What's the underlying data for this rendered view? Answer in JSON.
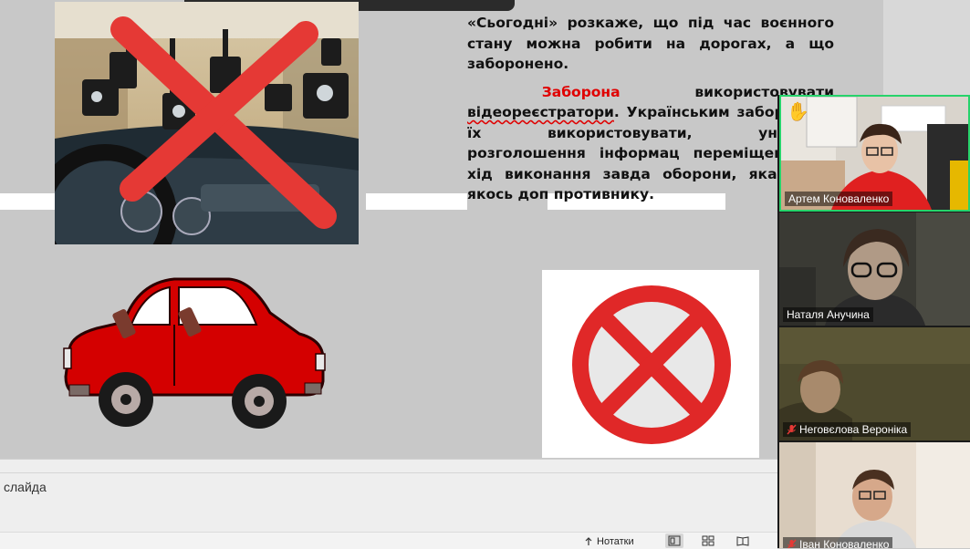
{
  "slide": {
    "paragraph1": "«Сьогодні» розкаже, що під час воєнного стану можна робити на дорогах, а що заборонено.",
    "paragraph2_red": "Заборона",
    "paragraph2_rest_a": " використовувати ",
    "paragraph2_squiggle": "відеореєстратори",
    "paragraph2_rest_b": ". Українським заборонили їх використовувати, уникнути розголошення інформац переміщення та хід виконання завда оборони, яка може якось доп противнику."
  },
  "notes": {
    "placeholder": "слайда"
  },
  "status_bar": {
    "notes_label": "Нотатки",
    "icons": [
      "notes-icon",
      "normal-view-icon",
      "slide-sorter-icon",
      "reading-view-icon"
    ]
  },
  "participants": [
    {
      "name": "Артем Коноваленко",
      "active_speaker": true,
      "hand_raised": true,
      "muted": false
    },
    {
      "name": "Наталя Анучина",
      "active_speaker": false,
      "hand_raised": false,
      "muted": false
    },
    {
      "name": "Неговєлова Вероніка",
      "active_speaker": false,
      "hand_raised": false,
      "muted": true
    },
    {
      "name": "Іван Коноваленко",
      "active_speaker": false,
      "hand_raised": false,
      "muted": true
    }
  ],
  "colors": {
    "active_speaker_border": "#27d36b",
    "prohibition_red": "#e53935",
    "car_red": "#d40000",
    "heading_red": "#e00000"
  }
}
